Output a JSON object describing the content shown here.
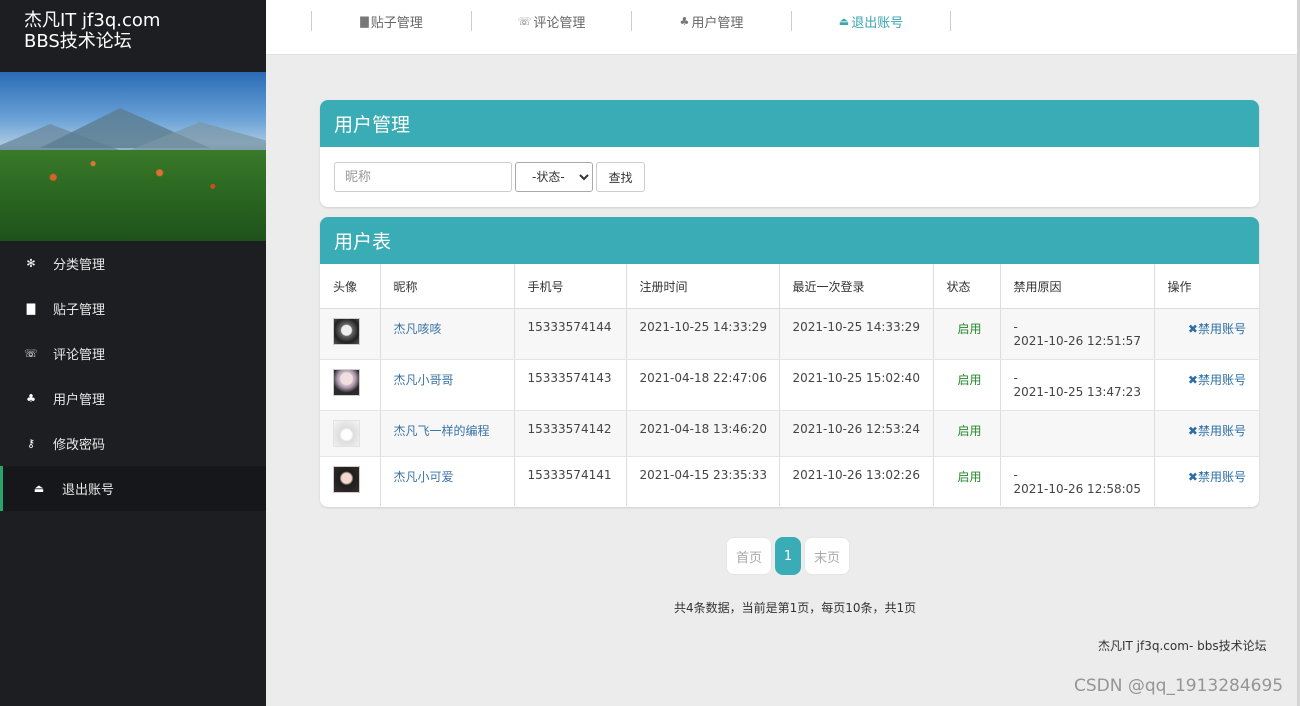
{
  "brand": {
    "line1": "杰凡IT jf3q.com",
    "line2": "BBS技术论坛"
  },
  "sidebar": {
    "items": [
      {
        "label": "分类管理",
        "icon": "gear-icon",
        "glyph": "✻"
      },
      {
        "label": "贴子管理",
        "icon": "file-icon",
        "glyph": "▇"
      },
      {
        "label": "评论管理",
        "icon": "comments-icon",
        "glyph": "☏"
      },
      {
        "label": "用户管理",
        "icon": "users-icon",
        "glyph": "♣"
      },
      {
        "label": "修改密码",
        "icon": "key-icon",
        "glyph": "⚷"
      },
      {
        "label": "退出账号",
        "icon": "eject-icon",
        "glyph": "⏏",
        "active": true
      }
    ]
  },
  "topnav": {
    "items": [
      {
        "label": "贴子管理",
        "icon": "file-icon",
        "glyph": "▇"
      },
      {
        "label": "评论管理",
        "icon": "comments-icon",
        "glyph": "☏"
      },
      {
        "label": "用户管理",
        "icon": "users-icon",
        "glyph": "♣"
      },
      {
        "label": "退出账号",
        "icon": "eject-icon",
        "glyph": "⏏"
      }
    ]
  },
  "search_panel": {
    "title": "用户管理",
    "nickname_placeholder": "昵称",
    "status_selected": "-状态-",
    "search_label": "查找"
  },
  "table_panel": {
    "title": "用户表",
    "headers": [
      "头像",
      "昵称",
      "手机号",
      "注册时间",
      "最近一次登录",
      "状态",
      "禁用原因",
      "操作"
    ],
    "rows": [
      {
        "nickname": "杰凡咳咳",
        "phone": "15333574144",
        "registered": "2021-10-25 14:33:29",
        "last_login": "2021-10-25 14:33:29",
        "status": "启用",
        "ban_dash": "-",
        "ban_time": "2021-10-26 12:51:57",
        "action": "禁用账号"
      },
      {
        "nickname": "杰凡小哥哥",
        "phone": "15333574143",
        "registered": "2021-04-18 22:47:06",
        "last_login": "2021-10-25 15:02:40",
        "status": "启用",
        "ban_dash": "-",
        "ban_time": "2021-10-25 13:47:23",
        "action": "禁用账号"
      },
      {
        "nickname": "杰凡飞一样的编程",
        "phone": "15333574142",
        "registered": "2021-04-18 13:46:20",
        "last_login": "2021-10-26 12:53:24",
        "status": "启用",
        "ban_dash": "",
        "ban_time": "",
        "action": "禁用账号"
      },
      {
        "nickname": "杰凡小可爱",
        "phone": "15333574141",
        "registered": "2021-04-15 23:35:33",
        "last_login": "2021-10-26 13:02:26",
        "status": "启用",
        "ban_dash": "-",
        "ban_time": "2021-10-26 12:58:05",
        "action": "禁用账号"
      }
    ]
  },
  "pagination": {
    "first": "首页",
    "current": "1",
    "last": "末页",
    "info": "共4条数据，当前是第1页，每页10条，共1页"
  },
  "footer": "杰凡IT jf3q.com- bbs技术论坛",
  "watermark": "CSDN @qq_1913284695",
  "colors": {
    "accent": "#3aacb5",
    "sidebar_bg": "#1d1e22",
    "status_enabled": "#268a2e",
    "link": "#3a74a8"
  }
}
